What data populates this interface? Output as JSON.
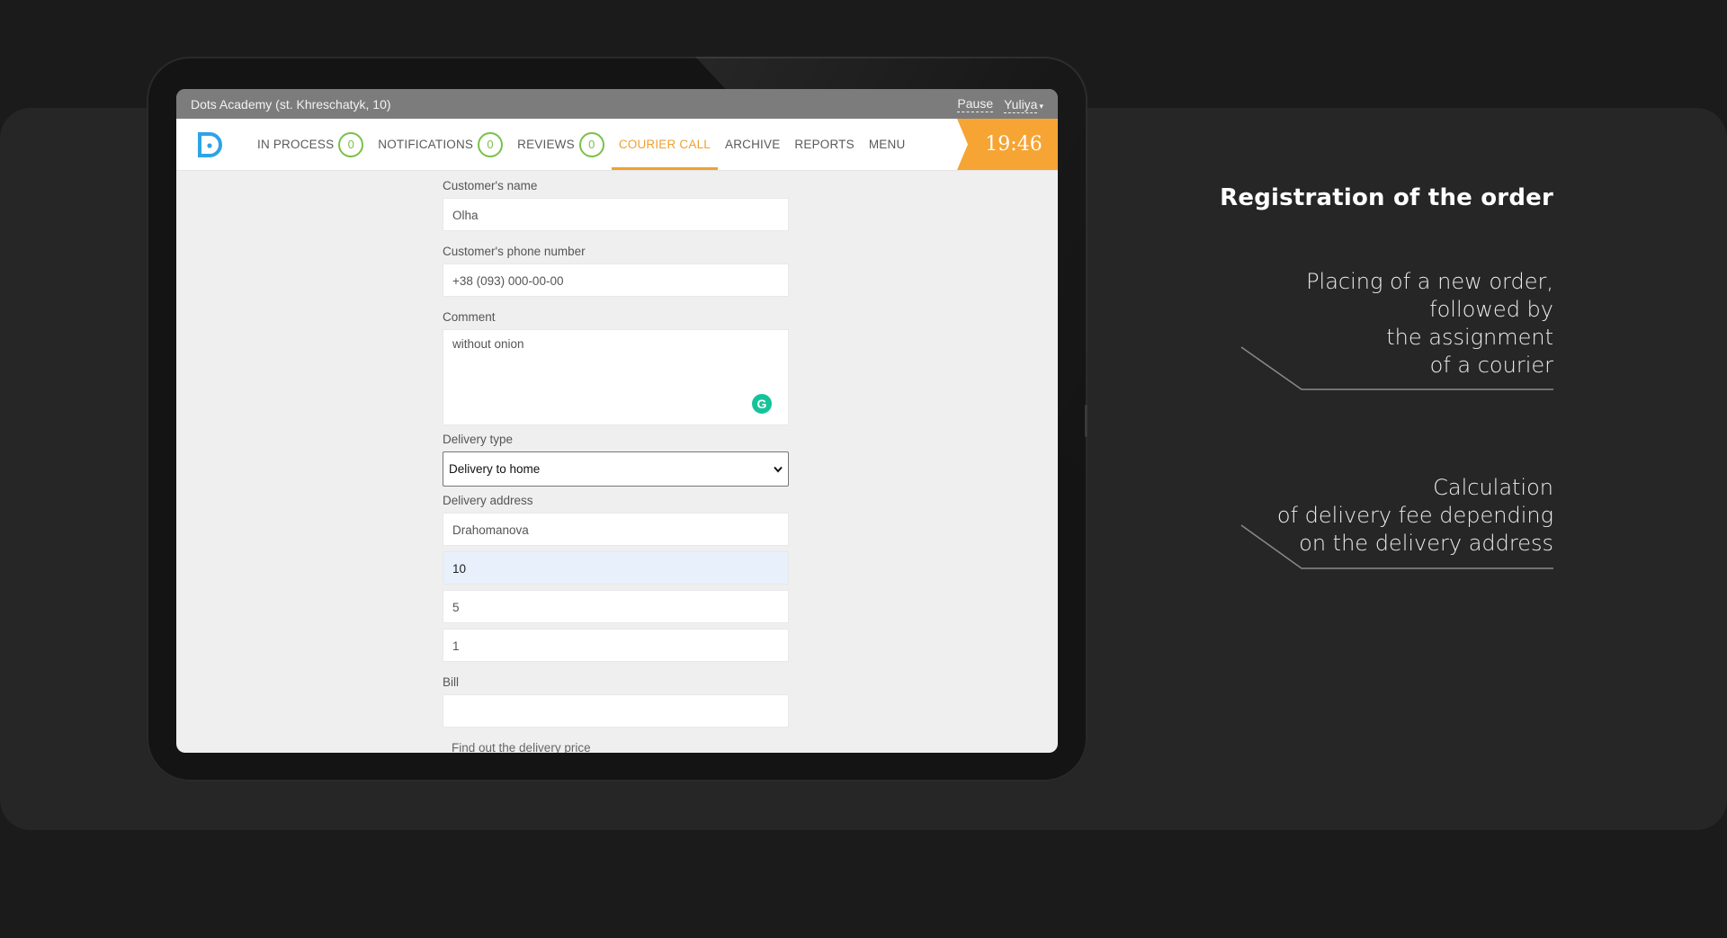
{
  "app": {
    "venue_title": "Dots Academy (st. Khreschatyk, 10)",
    "pause_label": "Pause",
    "user_name": "Yuliya"
  },
  "nav": {
    "in_process": {
      "label": "IN PROCESS",
      "count": "0"
    },
    "notifications": {
      "label": "NOTIFICATIONS",
      "count": "0"
    },
    "reviews": {
      "label": "REVIEWS",
      "count": "0"
    },
    "courier_call": {
      "label": "COURIER CALL"
    },
    "archive": {
      "label": "ARCHIVE"
    },
    "reports": {
      "label": "REPORTS"
    },
    "menu": {
      "label": "MENU"
    },
    "active_tab": "COURIER CALL",
    "clock": "19:46"
  },
  "form": {
    "customer_name": {
      "label": "Customer's name",
      "value": "Olha"
    },
    "customer_phone": {
      "label": "Customer's phone number",
      "value": "+38 (093) 000-00-00"
    },
    "comment": {
      "label": "Comment",
      "value": "without onion"
    },
    "delivery_type": {
      "label": "Delivery type",
      "selected": "Delivery to home"
    },
    "delivery_address": {
      "label": "Delivery address",
      "street": "Drahomanova",
      "building": "10",
      "entrance": "5",
      "apartment": "1"
    },
    "bill": {
      "label": "Bill",
      "value": ""
    },
    "delivery_price_link": "Find out the delivery price"
  },
  "callouts": {
    "heading": "Registration of the order",
    "placing": [
      "Placing of a new order,",
      "followed by",
      "the assignment",
      "of a courier"
    ],
    "calculation": [
      "Calculation",
      "of delivery fee depending",
      "on the delivery address"
    ]
  },
  "colors": {
    "accent_orange": "#f6a433",
    "badge_green": "#7ac04a",
    "logo_blue": "#2ea3e6",
    "grammarly_green": "#15c39a"
  }
}
